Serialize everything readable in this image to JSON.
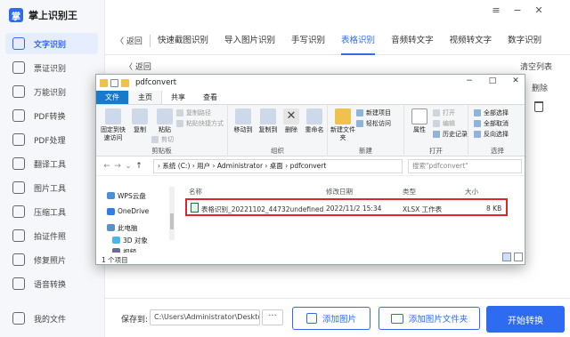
{
  "app": {
    "name": "掌上识别王",
    "logo_char": "掌"
  },
  "sidebar": {
    "items": [
      {
        "label": "文字识别",
        "active": true
      },
      {
        "label": "票证识别"
      },
      {
        "label": "万能识别"
      },
      {
        "label": "PDF转换"
      },
      {
        "label": "PDF处理"
      },
      {
        "label": "翻译工具"
      },
      {
        "label": "图片工具"
      },
      {
        "label": "压缩工具"
      },
      {
        "label": "拍证件照"
      },
      {
        "label": "修复照片"
      },
      {
        "label": "语音转换"
      }
    ],
    "my_files": "我的文件"
  },
  "window_controls": {
    "menu": "≡",
    "minimize": "−",
    "close": "✕"
  },
  "tabs": {
    "back": "〈 返回",
    "items": [
      "快速截图识别",
      "导入图片识别",
      "手写识别",
      "表格识别",
      "音频转文字",
      "视频转文字",
      "数字识别"
    ],
    "active_index": 3
  },
  "content": {
    "back": "〈 返回",
    "clear_list": "清空列表",
    "delete_col": "删除"
  },
  "bottom": {
    "save_label": "保存到:",
    "save_path": "C:\\Users\\Administrator\\Deskto...",
    "more": "···",
    "add_image": "添加图片",
    "add_folder": "添加图片文件夹",
    "start": "开始转换"
  },
  "explorer": {
    "title": "pdfconvert",
    "ribbon_tabs": [
      "文件",
      "主页",
      "共享",
      "查看"
    ],
    "ribbon": {
      "pin": "固定到快速访问",
      "copy": "复制",
      "paste": "粘贴",
      "copy_path": "复制路径",
      "paste_shortcut": "粘贴快捷方式",
      "cut": "剪切",
      "clipboard": "剪贴板",
      "move_to": "移动到",
      "copy_to": "复制到",
      "delete": "删除",
      "rename": "重命名",
      "organize": "组织",
      "new_folder": "新建文件夹",
      "new_item": "新建项目",
      "easy_access": "轻松访问",
      "new": "新建",
      "properties": "属性",
      "open": "打开",
      "edit": "编辑",
      "history": "历史记录",
      "open_group": "打开",
      "select_all": "全部选择",
      "select_none": "全部取消",
      "invert": "反向选择",
      "select": "选择"
    },
    "address": "› 系统 (C:)  ›  用户  ›  Administrator  ›  桌面  ›  pdfconvert",
    "search_placeholder": "搜索\"pdfconvert\"",
    "nav_pane": [
      {
        "label": "WPS云盘",
        "color": "#4a8fd8"
      },
      {
        "label": "OneDrive",
        "color": "#2f7de1"
      },
      {
        "label": "此电脑",
        "color": "#5b8fc7"
      },
      {
        "label": "3D 对象",
        "color": "#4cb5e8"
      },
      {
        "label": "视频",
        "color": "#6a6a9a"
      }
    ],
    "columns": [
      "名称",
      "修改日期",
      "类型",
      "大小"
    ],
    "file": {
      "name": "表格识别_20221102_44732undefined",
      "modified": "2022/11/2 15:34",
      "type": "XLSX 工作表",
      "size": "8 KB"
    },
    "status": "1 个项目"
  },
  "colors": {
    "accent": "#2f6bf0",
    "highlight_border": "#e0242a",
    "file_tab": "#1979ca"
  }
}
